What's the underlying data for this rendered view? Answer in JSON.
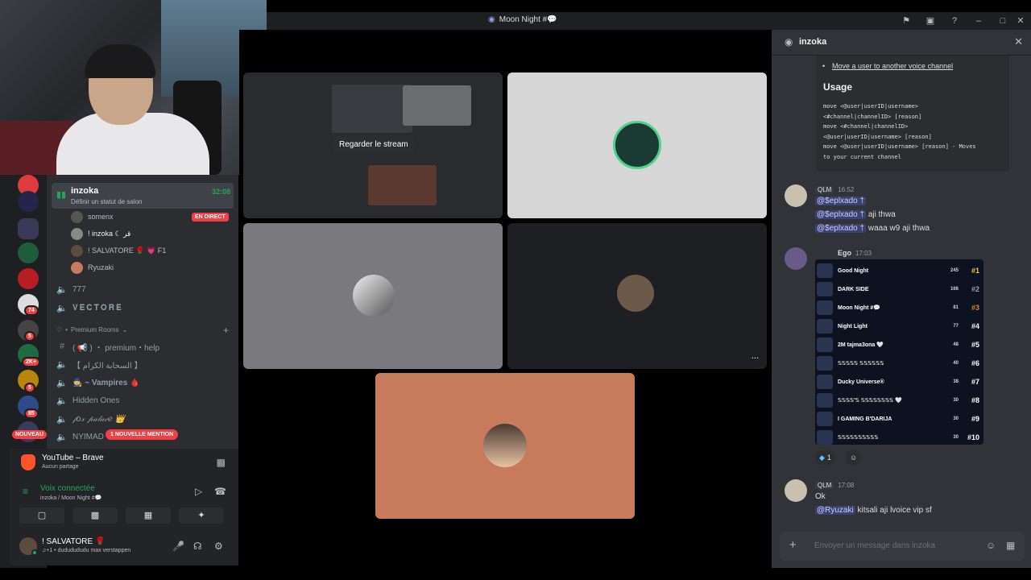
{
  "window": {
    "title": "Moon Night #💬"
  },
  "webcam": {
    "label": "webcam overlay"
  },
  "guilds": {
    "badges": [
      "74",
      "5",
      "2K+",
      "5",
      "85"
    ],
    "new_label": "NOUVEAU"
  },
  "sidebar": {
    "active_channel": {
      "name": "inzoka",
      "status": "Définir un statut de salon",
      "timer": "32:08"
    },
    "members": [
      {
        "name": "somenx"
      },
      {
        "name": "! inzoka ☾ قر"
      },
      {
        "name": "! SALVATORE 🌹 💗 F1"
      },
      {
        "name": "Ryuzaki"
      }
    ],
    "live_badge": "EN DIRECT",
    "channels": [
      {
        "name": "777",
        "icon": "voice"
      },
      {
        "name": "𝐕𝐄𝐂𝐓𝐎𝐑𝐄",
        "icon": "voice"
      }
    ],
    "category": "Premium Rooms",
    "channels2": [
      {
        "name": "( 📢 ) ・ premium・help",
        "icon": "text"
      },
      {
        "name": "【 السحابة الكرام 】",
        "icon": "voice"
      },
      {
        "name": "🧙 ~ Vampires 🩸",
        "icon": "voice"
      },
      {
        "name": "Hidden Ones",
        "icon": "voice"
      },
      {
        "name": "𝒻𝑜𝓍 𝓅𝒶𝓁𝒶𝒸𝑒 👑",
        "icon": "voice"
      },
      {
        "name": "NYIMAD",
        "icon": "voice"
      }
    ],
    "mention_pill": "1 NOUVELLE MENTION"
  },
  "stream_panel": {
    "title": "YouTube – Brave",
    "subtitle": "Aucun partage"
  },
  "voice_panel": {
    "title": "Voix connectée",
    "subtitle": "inzoka / Moon Night #💬"
  },
  "user_panel": {
    "name": "! SALVATORE 🌹",
    "activity": "♫+1 • dududududu max verstappen"
  },
  "stage": {
    "watch_label": "Regarder le stream",
    "more_label": "..."
  },
  "chat": {
    "header": "inzoka",
    "embed": {
      "link": "Move a user to another voice channel",
      "heading": "Usage",
      "code": [
        "move <@user|userID|username>",
        "<#channel|channelID> [reason]",
        "move <#channel|channelID>",
        "<@user|userID|username> [reason]",
        "move <@user|userID|username> [reason] - Moves",
        "to your current channel"
      ]
    },
    "msg1": {
      "badge": "QLM",
      "time": "16:52",
      "lines": [
        {
          "mention": "@$eplxado †",
          "text": ""
        },
        {
          "mention": "@$eplxado †",
          "text": " aji thwa"
        },
        {
          "mention": "@$eplxado †",
          "text": " waaa w9 aji thwa"
        }
      ]
    },
    "msg2": {
      "author": "Ego",
      "time": "17:03"
    },
    "leaderboard": [
      {
        "name": "Good Night",
        "score": "245",
        "rank": "#1",
        "color": "#f5c542"
      },
      {
        "name": "DARK SIDE",
        "score": "166",
        "rank": "#2",
        "color": "#9aa0ad"
      },
      {
        "name": "Moon Night #💬",
        "score": "81",
        "rank": "#3",
        "color": "#d58a2b"
      },
      {
        "name": "Night Light",
        "score": "77",
        "rank": "#4",
        "color": "#ffffff"
      },
      {
        "name": "2M tajma3ona 🤍",
        "score": "48",
        "rank": "#5",
        "color": "#ffffff"
      },
      {
        "name": "𝕊𝕊𝕊𝕊𝕊 𝕊𝕊𝕊𝕊𝕊𝕊",
        "score": "40",
        "rank": "#6",
        "color": "#ffffff"
      },
      {
        "name": "Ducky Universe®",
        "score": "38",
        "rank": "#7",
        "color": "#ffffff"
      },
      {
        "name": "𝕊𝕊𝕊𝕊'𝕊 𝕊𝕊𝕊𝕊𝕊𝕊𝕊𝕊 🤍",
        "score": "30",
        "rank": "#8",
        "color": "#ffffff"
      },
      {
        "name": "I GAMING B'DARIJA",
        "score": "30",
        "rank": "#9",
        "color": "#ffffff"
      },
      {
        "name": "𝕊𝕊𝕊𝕊𝕊𝕊𝕊𝕊𝕊𝕊",
        "score": "30",
        "rank": "#10",
        "color": "#ffffff"
      }
    ],
    "reaction_count": "1",
    "msg3": {
      "badge": "QLM",
      "time": "17:08",
      "line1": "Ok",
      "mention": "@Ryuzaki",
      "text": " kitsali aji lvoice vip sf"
    },
    "composer_placeholder": "Envoyer un message dans inzoka"
  },
  "colors": {
    "accent": "#5865f2",
    "online": "#23a559",
    "danger": "#f23f43",
    "tile_orange": "#c87a5c",
    "tile_gray": "#7a7a7e"
  }
}
